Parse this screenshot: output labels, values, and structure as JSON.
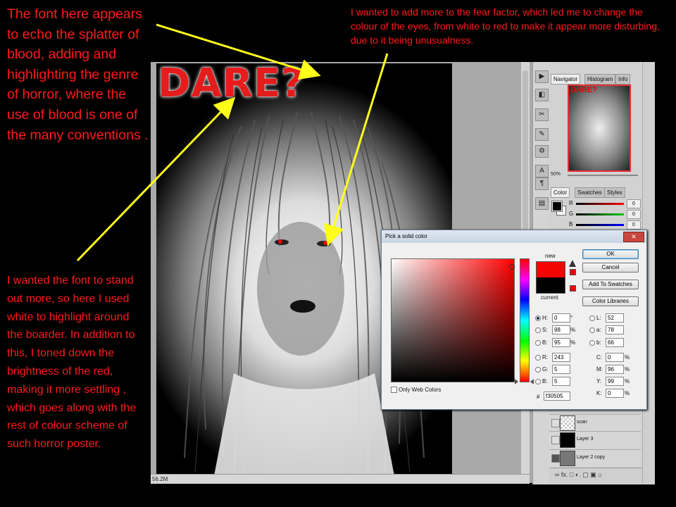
{
  "annotations": {
    "left_top": "The font here appears to echo the splatter of blood, adding and highlighting the genre of horror, where the use of blood is one of the many conventions .",
    "top_right": "I wanted to add more to the fear factor, which led me to change the colour of the eyes, from white to red to make it appear more disturbing, due to it being unusualness.",
    "left_bottom": "I wanted the font to stand out more, so here I used white to highlight around the boarder.  In addition to this, I toned down the brightness of the red, making it more settling , which goes along with the rest of colour scheme of such horror poster."
  },
  "poster": {
    "title": "DARE?"
  },
  "status_bar": {
    "zoom": "56.2M"
  },
  "tools": [
    "move-tool",
    "brush-tool",
    "clone-tool",
    "history-tool",
    "eraser-tool",
    "type-tool",
    "pen-tool",
    "notes-tool"
  ],
  "navigator": {
    "tabs": [
      "Navigator",
      "Histogram",
      "Info"
    ],
    "thumb_title": "DARE?",
    "zoom": "50%"
  },
  "color_panel": {
    "tabs": [
      "Color",
      "Swatches",
      "Styles"
    ],
    "channels": [
      {
        "label": "R",
        "value": "0"
      },
      {
        "label": "G",
        "value": "0"
      },
      {
        "label": "B",
        "value": "0"
      }
    ]
  },
  "layers": [
    {
      "name": "scan"
    },
    {
      "name": "Layer 3"
    },
    {
      "name": "Layer 2 copy"
    }
  ],
  "layers_footer": "∞  fx.  □  ◐.  ▢  ▣  ⌂",
  "picker": {
    "title": "Pick a solid color",
    "new_label": "new",
    "current_label": "current",
    "buttons": {
      "ok": "OK",
      "cancel": "Cancel",
      "add_swatches": "Add To Swatches",
      "libraries": "Color Libraries"
    },
    "hsb": [
      {
        "label": "H:",
        "value": "0",
        "unit": "°",
        "selected": true
      },
      {
        "label": "S:",
        "value": "98",
        "unit": "%",
        "selected": false
      },
      {
        "label": "B:",
        "value": "95",
        "unit": "%",
        "selected": false
      }
    ],
    "rgb": [
      {
        "label": "R:",
        "value": "243"
      },
      {
        "label": "G:",
        "value": "5"
      },
      {
        "label": "B:",
        "value": "5"
      }
    ],
    "lab": [
      {
        "label": "L:",
        "value": "52"
      },
      {
        "label": "a:",
        "value": "78"
      },
      {
        "label": "b:",
        "value": "66"
      }
    ],
    "cmyk": [
      {
        "label": "C:",
        "value": "0",
        "unit": "%"
      },
      {
        "label": "M:",
        "value": "96",
        "unit": "%"
      },
      {
        "label": "Y:",
        "value": "99",
        "unit": "%"
      },
      {
        "label": "K:",
        "value": "0",
        "unit": "%"
      }
    ],
    "hex_label": "#",
    "hex": "f30505",
    "web_only_label": "Only Web Colors",
    "new_color": "#f30505",
    "current_color": "#000000"
  },
  "colors": {
    "annotation_text": "#ff1a1a",
    "arrow": "#ffff1a",
    "title_red": "#e41c1c"
  }
}
